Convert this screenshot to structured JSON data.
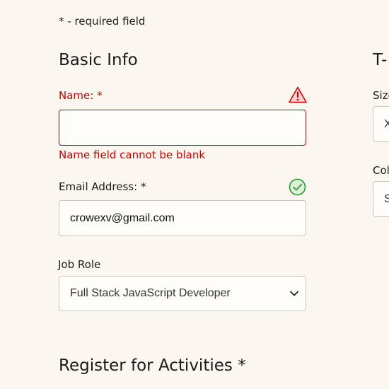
{
  "required_note": "* - required field",
  "basic_info": {
    "heading": "Basic Info",
    "name": {
      "label": "Name:",
      "required_mark": "*",
      "value": "",
      "error": "Name field cannot be blank",
      "status_icon": "warning-icon",
      "status_color": "#d40000"
    },
    "email": {
      "label": "Email Address:",
      "required_mark": "*",
      "value": "crowexv@gmail.com",
      "status_icon": "check-circle-icon",
      "status_color": "#3aa23a"
    },
    "job_role": {
      "label": "Job Role",
      "selected": "Full Stack JavaScript Developer"
    }
  },
  "tshirt": {
    "heading_partial": "T-",
    "size": {
      "label_partial": "Size",
      "value_partial": "X"
    },
    "color": {
      "label_partial": "Col",
      "value_partial": "S"
    }
  },
  "activities": {
    "heading": "Register for Activities",
    "required_mark": "*"
  },
  "colors": {
    "background": "#fbf7f0",
    "error": "#d40000",
    "valid": "#3aa23a"
  }
}
